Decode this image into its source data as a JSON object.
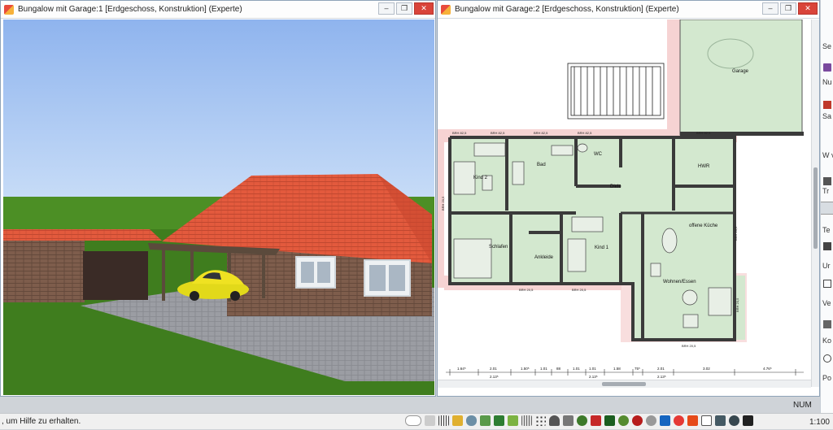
{
  "window_3d": {
    "title": "Bungalow mit Garage:1 [Erdgeschoss, Konstruktion] (Experte)"
  },
  "window_plan": {
    "title": "Bungalow mit Garage:2 [Erdgeschoss, Konstruktion] (Experte)",
    "rooms": {
      "garage": "Garage",
      "kind2": "Kind 2",
      "bad": "Bad",
      "wc": "WC",
      "hwr": "HWR",
      "diele": "Diele",
      "offene_kueche": "offene Küche",
      "schlafen": "Schlafen",
      "ankleide": "Ankleide",
      "kind1": "Kind 1",
      "wohnen_essen": "Wohnen/Essen"
    },
    "window_labels": [
      "BRH 82,5",
      "BRH 82,5",
      "BRH 82,5",
      "BRH 82,5",
      "BRH 82,5",
      "BRH 20,5",
      "BRH 20,5",
      "BRH 20,5",
      "BRH 20,5",
      "BRH 20,5",
      "BRH 20,5"
    ],
    "dimensions_top": [
      "1.64⁵",
      "2.01",
      "1.50⁵",
      "1.01",
      "88",
      "1.01",
      "1.01",
      "1.58",
      "75⁵",
      "2.01",
      "3.02",
      "4.76⁵"
    ],
    "dimensions_bottom": [
      "2.13⁵",
      "2.13⁵",
      "2.13⁵"
    ]
  },
  "right_panel": {
    "items": [
      "Se",
      "Nu s",
      "Sa de",
      "W ve",
      "Tr",
      "Te",
      "Ur",
      "Ve",
      "Ko",
      "Po"
    ]
  },
  "statusbar": {
    "hint": ", um Hilfe zu erhalten.",
    "num": "NUM",
    "scale": "1:100"
  },
  "colors": {
    "sky": "#a9c7f2",
    "grass": "#3f7d1e",
    "roof": "#e0553a",
    "brick": "#7a5a4a",
    "room_fill": "#d3e8cf",
    "wall": "#3a3a3a",
    "pink_zone": "#f6d3d3"
  }
}
